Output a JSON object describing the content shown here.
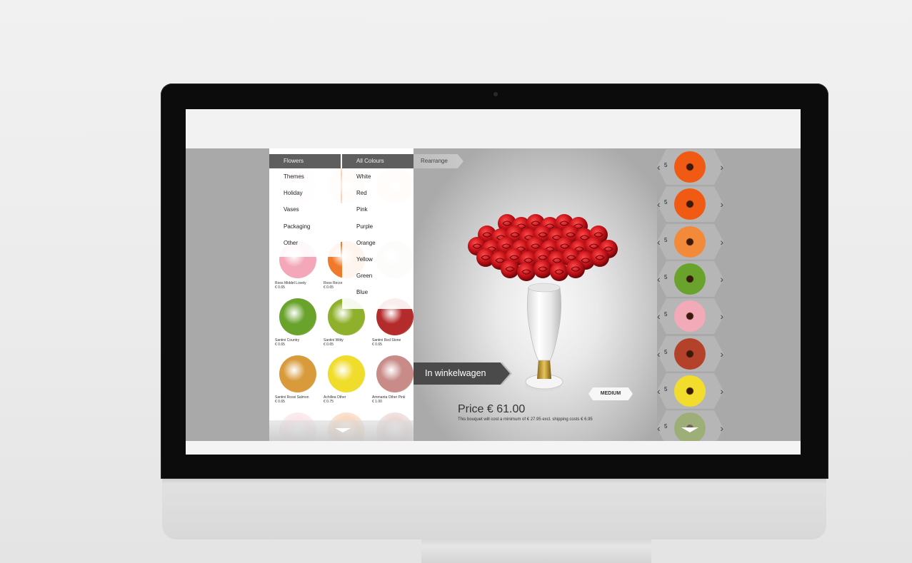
{
  "dropdowns": {
    "category": {
      "label": "Flowers",
      "items": [
        "Themes",
        "Holiday",
        "Vases",
        "Packaging",
        "Other"
      ]
    },
    "colour": {
      "label": "All Colours",
      "items": [
        "White",
        "Red",
        "Pink",
        "Purple",
        "Orange",
        "Yellow",
        "Green",
        "Blue"
      ]
    }
  },
  "rearrange_label": "Rearrange",
  "catalog": [
    {
      "name": "Roos Middel Lovely",
      "price": "€ 0.65",
      "color": "#f3a7b9",
      "icon": "pink-rose-icon"
    },
    {
      "name": "Roos Recon",
      "price": "€ 0.65",
      "color": "#f07a2b",
      "icon": "orange-rose-icon"
    },
    {
      "name": "",
      "price": "",
      "color": "#d9d4cc",
      "icon": "flower-icon"
    },
    {
      "name": "Santini Country",
      "price": "€ 0.65",
      "color": "#6aa32c",
      "icon": "green-chrysanthemum-icon"
    },
    {
      "name": "Santini Witty",
      "price": "€ 0.65",
      "color": "#8fb02a",
      "icon": "green-chrysanthemum-icon"
    },
    {
      "name": "Santini Red Stone",
      "price": "€ 0.65",
      "color": "#b42b2b",
      "icon": "red-chrysanthemum-icon"
    },
    {
      "name": "Santini Rossi Salmon",
      "price": "€ 0.65",
      "color": "#d89a3a",
      "icon": "orange-chrysanthemum-icon"
    },
    {
      "name": "Achillea Other",
      "price": "€ 0.75",
      "color": "#f0dc2a",
      "icon": "yellow-achillea-icon"
    },
    {
      "name": "Ammanta Other Pink",
      "price": "€ 1.00",
      "color": "#c88b88",
      "icon": "pink-cluster-icon"
    }
  ],
  "cart_button": "In winkelwagen",
  "size_label": "MEDIUM",
  "price": "Price € 61.00",
  "price_note": "This bouquet will cost a minimum of € 27.95 excl. shipping costs € 6.95",
  "selected": [
    {
      "qty": "5",
      "color": "#f05a12",
      "icon": "orange-gerbera-icon"
    },
    {
      "qty": "5",
      "color": "#f05a12",
      "icon": "orange-gerbera-icon"
    },
    {
      "qty": "5",
      "color": "#f38a3a",
      "icon": "orange-rose-icon"
    },
    {
      "qty": "5",
      "color": "#6aa32c",
      "icon": "green-chrysanthemum-icon"
    },
    {
      "qty": "5",
      "color": "#f2a9b8",
      "icon": "pink-rose-icon"
    },
    {
      "qty": "5",
      "color": "#b4412a",
      "icon": "red-chrysanthemum-icon"
    },
    {
      "qty": "5",
      "color": "#f3dd2c",
      "icon": "yellow-achillea-icon"
    },
    {
      "qty": "5",
      "color": "#8aa844",
      "icon": "green-flower-icon"
    }
  ]
}
